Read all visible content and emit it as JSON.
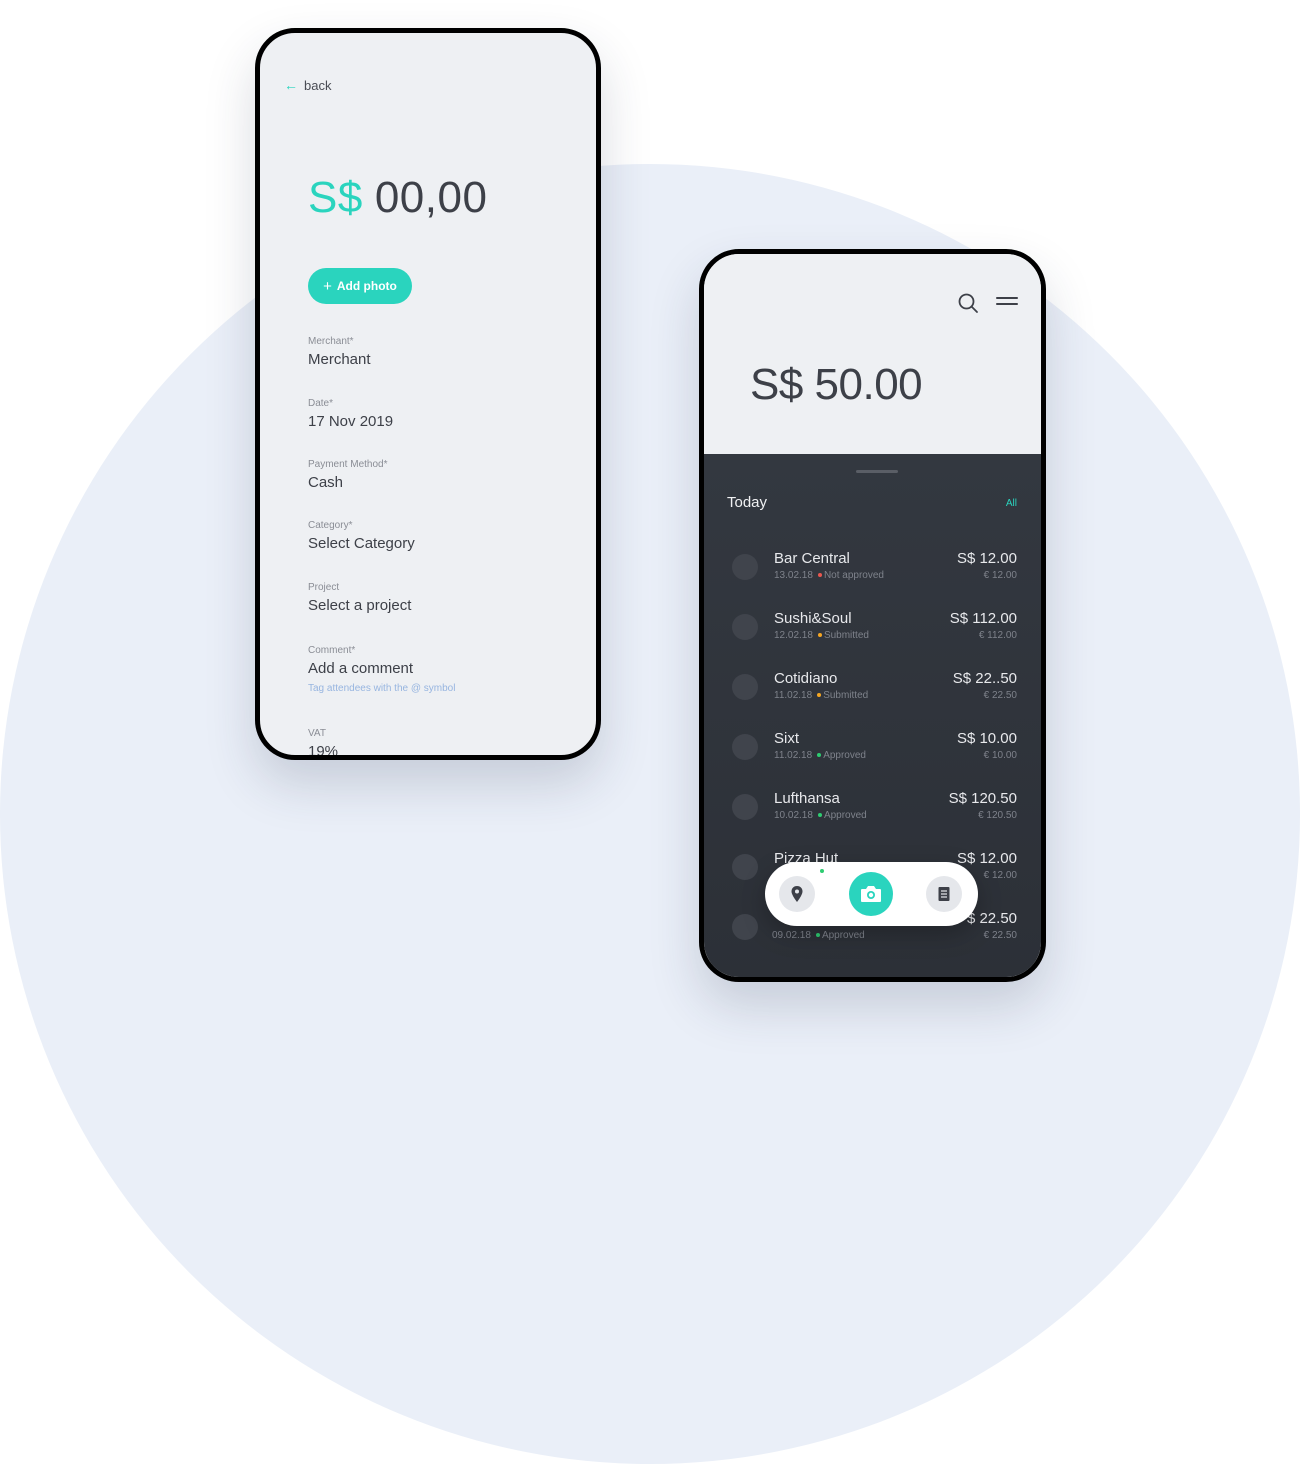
{
  "form": {
    "back_label": "back",
    "currency": "S$",
    "amount": "00,00",
    "add_photo_label": "Add photo",
    "fields": [
      {
        "label": "Merchant*",
        "value": "Merchant"
      },
      {
        "label": "Date*",
        "value": "17 Nov 2019"
      },
      {
        "label": "Payment Method*",
        "value": "Cash"
      },
      {
        "label": "Category*",
        "value": "Select Category"
      },
      {
        "label": "Project",
        "value": "Select a project"
      },
      {
        "label": "Comment*",
        "value": "Add a comment",
        "hint": "Tag attendees with the @ symbol"
      },
      {
        "label": "VAT",
        "value": "19%"
      }
    ]
  },
  "list": {
    "balance": "S$ 50.00",
    "section_title": "Today",
    "all_label": "All",
    "transactions": [
      {
        "name": "Bar Central",
        "date": "13.02.18",
        "status": "Not approved",
        "status_color": "#e8574f",
        "amount": "S$ 12.00",
        "eur": "€ 12.00"
      },
      {
        "name": "Sushi&Soul",
        "date": "12.02.18",
        "status": "Submitted",
        "status_color": "#f5a623",
        "amount": "S$ 112.00",
        "eur": "€ 112.00"
      },
      {
        "name": "Cotidiano",
        "date": "11.02.18",
        "status": "Submitted",
        "status_color": "#f5a623",
        "amount": "S$ 22..50",
        "eur": "€ 22.50"
      },
      {
        "name": "Sixt",
        "date": "11.02.18",
        "status": "Approved",
        "status_color": "#2ecc71",
        "amount": "S$ 10.00",
        "eur": "€ 10.00"
      },
      {
        "name": "Lufthansa",
        "date": "10.02.18",
        "status": "Approved",
        "status_color": "#2ecc71",
        "amount": "S$ 120.50",
        "eur": "€ 120.50"
      },
      {
        "name": "Pizza Hut",
        "date": "",
        "status": "",
        "status_color": "#2ecc71",
        "amount": "S$ 12.00",
        "eur": "€ 12.00"
      },
      {
        "name": "",
        "date": "09.02.18",
        "status": "Approved",
        "status_color": "#2ecc71",
        "amount": "$ 22.50",
        "eur": "€ 22.50"
      }
    ]
  },
  "colors": {
    "accent": "#2ad4be",
    "dark_panel": "#2f3339",
    "background_circle": "#eaeff8"
  },
  "icons": [
    "arrow-left-icon",
    "plus-icon",
    "search-icon",
    "menu-icon",
    "location-pin-icon",
    "camera-icon",
    "document-icon"
  ]
}
